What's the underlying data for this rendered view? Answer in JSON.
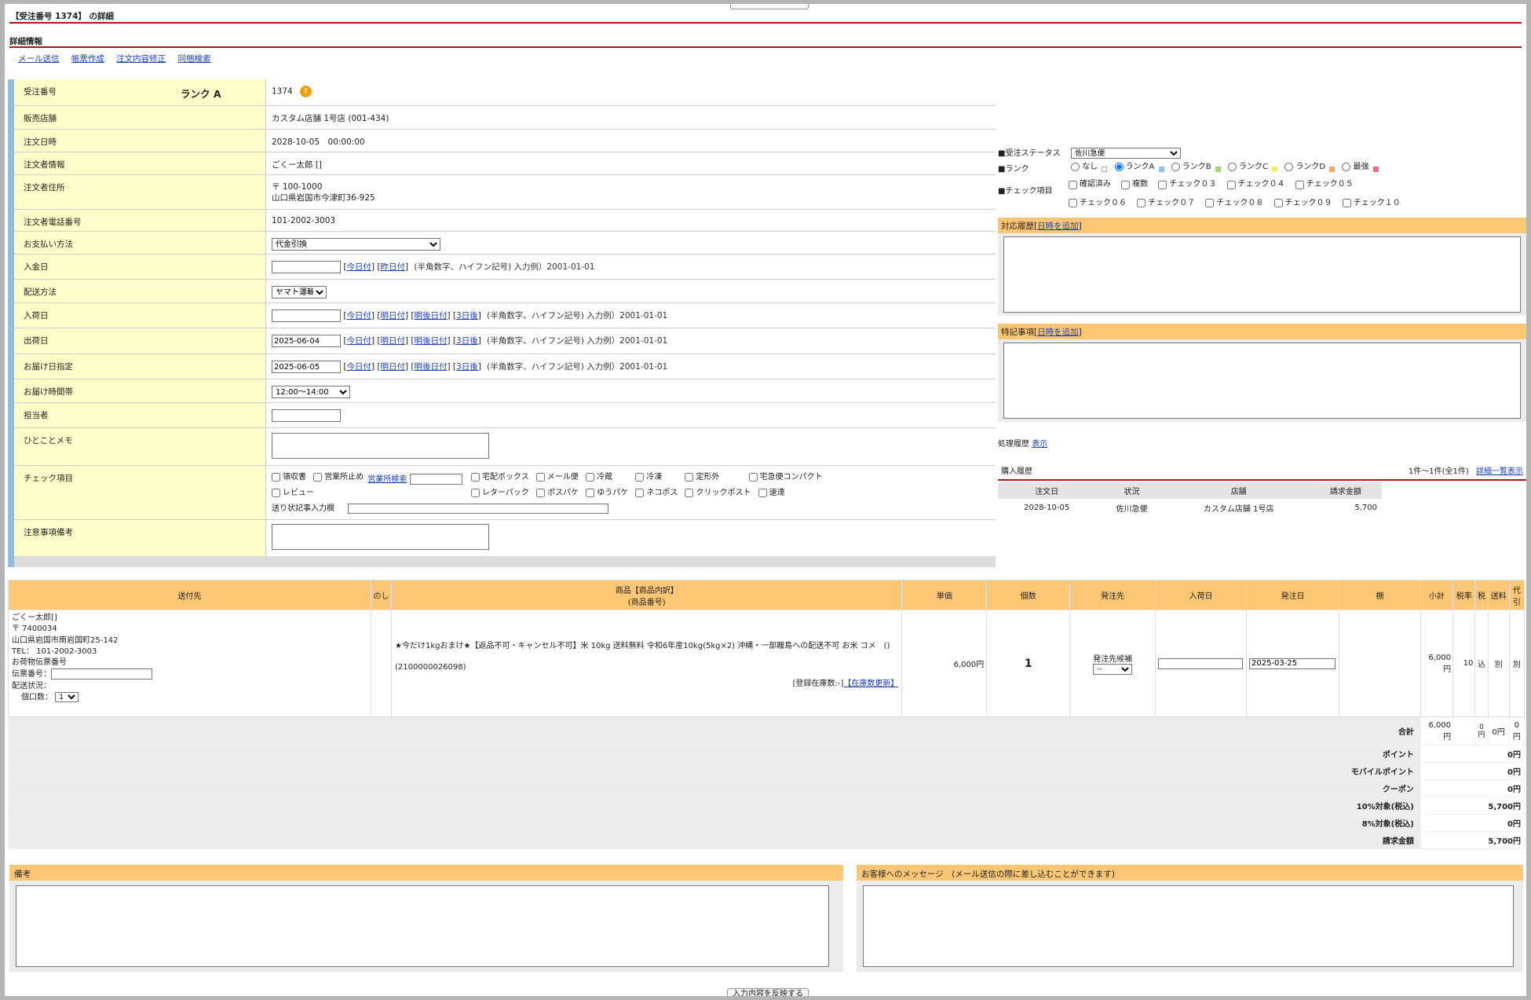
{
  "page_title": "【受注番号 1374】 の詳細",
  "section_title": "詳細情報",
  "actions": [
    "メール送信",
    "帳票作成",
    "注文内容修正",
    "同梱検索"
  ],
  "detail": {
    "order_no_label": "受注番号",
    "rank_text": "ランク A",
    "order_no": "1374",
    "warn_icon": "!",
    "shop_label": "販売店舗",
    "shop": "カスタム店舗 1号店 (001-434)",
    "order_dt_label": "注文日時",
    "order_dt": "2028-10-05　00:00:00",
    "customer_label": "注文者情報",
    "customer": "ごくー太郎 []",
    "address_label": "注文者住所",
    "zip": "〒 100-1000",
    "address": "山口県岩国市今津町36-925",
    "tel_label": "注文者電話番号",
    "tel": "101-2002-3003",
    "payment_label": "お支払い方法",
    "payment": "代金引換",
    "paid_label": "入金日",
    "paid_links": [
      "今日付",
      "昨日付"
    ],
    "date_hint": "(半角数字、ハイフン記号) 入力例）2001-01-01",
    "ship_method_label": "配送方法",
    "ship_method": "ヤマト運輸",
    "arrival_label": "入荷日",
    "date_links": [
      "今日付",
      "明日付",
      "明後日付",
      "3日後"
    ],
    "ship_date_label": "出荷日",
    "ship_date": "2025-06-04",
    "deliver_label": "お届け日指定",
    "deliver_date": "2025-06-05",
    "time_label": "お届け時間帯",
    "time_slot": "12:00〜14:00",
    "staff_label": "担当者",
    "memo_label": "ひとことメモ",
    "check_label": "チェック項目",
    "checks_row1a": [
      "領収書",
      "営業所止め"
    ],
    "eigyo_link": "営業所検索",
    "checks_row1b": [
      "宅配ボックス",
      "メール便",
      "冷蔵",
      "冷凍",
      "定形外",
      "宅急便コンパクト"
    ],
    "checks_row2a": [
      "レビュー"
    ],
    "checks_row2b": [
      "レターパック",
      "ポスパケ",
      "ゆうパケ",
      "ネコポス",
      "クリックポスト",
      "速達"
    ],
    "sender_label": "送り状記事入力欄",
    "notes_label": "注意事項備考"
  },
  "right": {
    "status_label": "■受注ステータス",
    "status": "佐川急便",
    "rank_label": "■ランク",
    "ranks": [
      {
        "label": "なし",
        "color": "#ffffff"
      },
      {
        "label": "ランクA",
        "color": "#8ec8e6"
      },
      {
        "label": "ランクB",
        "color": "#a8d478"
      },
      {
        "label": "ランクC",
        "color": "#f6e77a"
      },
      {
        "label": "ランクD",
        "color": "#f4a65c"
      },
      {
        "label": "最強",
        "color": "#f06c7c"
      }
    ],
    "check_label": "■チェック項目",
    "checks1": [
      "確認済み",
      "複数",
      "チェック０３",
      "チェック０４",
      "チェック０５"
    ],
    "checks2": [
      "チェック０６",
      "チェック０７",
      "チェック０８",
      "チェック０９",
      "チェック１０"
    ],
    "response_label": "対応履歴",
    "add_time": "日時を追加",
    "special_label": "特記事項",
    "process_label": "処理履歴",
    "process_link": "表示",
    "purchase_label": "購入履歴",
    "purchase_count": "1件〜1件(全1件)",
    "purchase_link": "詳細一覧表示",
    "history_headers": [
      "注文日",
      "状況",
      "店舗",
      "請求金額"
    ],
    "history_rows": [
      [
        "2028-10-05",
        "佐川急便",
        "カスタム店舗 1号店",
        "5,700"
      ]
    ]
  },
  "order": {
    "headers": [
      "送付先",
      "のし",
      "商品【商品内訳】",
      "(商品番号)",
      "単価",
      "個数",
      "発注先",
      "入荷日",
      "発注日",
      "棚",
      "小計",
      "税率",
      "税",
      "送料",
      "代引"
    ],
    "dest_lines": [
      "ごくー太郎[]",
      "〒 7400034",
      "山口県岩国市南岩国町25-142",
      "TEL： 101-2002-3003",
      "お荷物伝票番号"
    ],
    "slip_label": "伝票番号：",
    "ship_status_label": "配送状況：",
    "parcel_label": "個口数：",
    "parcel_count": "1",
    "product_name": "★今だけ1kgおまけ★【返品不可・キャンセル不可】米 10kg 送料無料 令和6年産10kg(5kg×2) 沖縄・一部離島への配送不可 お米 コメ　()",
    "product_code": "(2100000026098)",
    "stock_text": "[登録在庫数:-]",
    "stock_link": "【在庫数更新】",
    "unit_price": "6,000円",
    "qty": "1",
    "supplier_label": "発注先候補",
    "supplier": "--",
    "order_date": "2025-03-25",
    "subtotal": "6,000円",
    "tax_rate": "10",
    "tax": "込",
    "shipping": "別",
    "cod": "別"
  },
  "totals": {
    "sum_label": "合計",
    "sum_subtotal": "6,000円",
    "sum_tax_top": "0",
    "sum_tax_bottom": "円",
    "sum_shipping": "0円",
    "sum_cod": "0円",
    "rows": [
      {
        "label": "ポイント",
        "value": "0円"
      },
      {
        "label": "モバイルポイント",
        "value": "0円"
      },
      {
        "label": "クーポン",
        "value": "0円"
      },
      {
        "label": "10%対象(税込)",
        "value": "5,700円"
      },
      {
        "label": "8%対象(税込)",
        "value": "0円"
      },
      {
        "label": "請求金額",
        "value": "5,700円"
      }
    ]
  },
  "bottom": {
    "remarks_label": "備考",
    "message_label": "お客様へのメッセージ　(メール送信の際に差し込むことができます)",
    "submit_label": "入力内容を反映する"
  }
}
